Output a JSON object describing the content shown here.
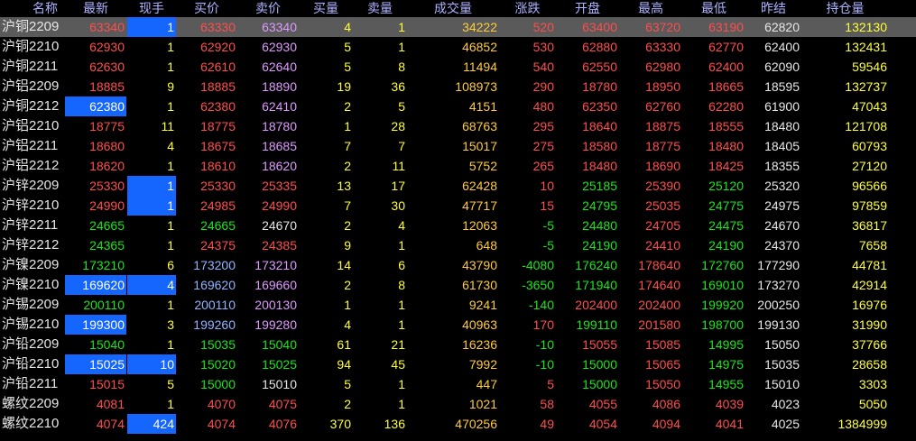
{
  "headers": {
    "name": "名称",
    "latest": "最新",
    "volume": "现手",
    "bid": "买价",
    "ask": "卖价",
    "bid_vol": "买量",
    "ask_vol": "卖量",
    "turnover": "成交量",
    "change": "涨跌",
    "open": "开盘",
    "high": "最高",
    "low": "最低",
    "prev_close": "昨结",
    "open_interest": "持仓量"
  },
  "rows": [
    {
      "name": "沪铜2209",
      "latest": "63340",
      "volume": "1",
      "bid": "63330",
      "ask": "63340",
      "bid_vol": "4",
      "ask_vol": "1",
      "turnover": "34222",
      "change": "520",
      "open": "63400",
      "high": "63720",
      "low": "63190",
      "prev_close": "62820",
      "open_interest": "132130"
    },
    {
      "name": "沪铜2210",
      "latest": "62930",
      "volume": "1",
      "bid": "62920",
      "ask": "62930",
      "bid_vol": "5",
      "ask_vol": "1",
      "turnover": "46852",
      "change": "530",
      "open": "62880",
      "high": "63330",
      "low": "62770",
      "prev_close": "62400",
      "open_interest": "132431"
    },
    {
      "name": "沪铜2211",
      "latest": "62630",
      "volume": "1",
      "bid": "62610",
      "ask": "62640",
      "bid_vol": "5",
      "ask_vol": "8",
      "turnover": "11494",
      "change": "540",
      "open": "62550",
      "high": "62980",
      "low": "62400",
      "prev_close": "62090",
      "open_interest": "59546"
    },
    {
      "name": "沪铝2209",
      "latest": "18885",
      "volume": "9",
      "bid": "18885",
      "ask": "18890",
      "bid_vol": "19",
      "ask_vol": "36",
      "turnover": "108973",
      "change": "290",
      "open": "18780",
      "high": "18950",
      "low": "18665",
      "prev_close": "18595",
      "open_interest": "132737"
    },
    {
      "name": "沪铜2212",
      "latest": "62380",
      "volume": "1",
      "bid": "62380",
      "ask": "62410",
      "bid_vol": "2",
      "ask_vol": "5",
      "turnover": "4151",
      "change": "480",
      "open": "62350",
      "high": "62760",
      "low": "62280",
      "prev_close": "61900",
      "open_interest": "47043"
    },
    {
      "name": "沪铝2210",
      "latest": "18775",
      "volume": "11",
      "bid": "18775",
      "ask": "18780",
      "bid_vol": "1",
      "ask_vol": "28",
      "turnover": "68763",
      "change": "295",
      "open": "18640",
      "high": "18875",
      "low": "18555",
      "prev_close": "18480",
      "open_interest": "121708"
    },
    {
      "name": "沪铝2211",
      "latest": "18680",
      "volume": "4",
      "bid": "18675",
      "ask": "18685",
      "bid_vol": "7",
      "ask_vol": "7",
      "turnover": "15017",
      "change": "275",
      "open": "18580",
      "high": "18775",
      "low": "18480",
      "prev_close": "18405",
      "open_interest": "60793"
    },
    {
      "name": "沪铝2212",
      "latest": "18620",
      "volume": "1",
      "bid": "18610",
      "ask": "18620",
      "bid_vol": "2",
      "ask_vol": "11",
      "turnover": "5752",
      "change": "265",
      "open": "18480",
      "high": "18690",
      "low": "18425",
      "prev_close": "18355",
      "open_interest": "27120"
    },
    {
      "name": "沪锌2209",
      "latest": "25330",
      "volume": "1",
      "bid": "25330",
      "ask": "25335",
      "bid_vol": "13",
      "ask_vol": "17",
      "turnover": "62428",
      "change": "10",
      "open": "25185",
      "high": "25390",
      "low": "25120",
      "prev_close": "25320",
      "open_interest": "96566"
    },
    {
      "name": "沪锌2210",
      "latest": "24990",
      "volume": "1",
      "bid": "24985",
      "ask": "24990",
      "bid_vol": "7",
      "ask_vol": "30",
      "turnover": "47717",
      "change": "15",
      "open": "24795",
      "high": "25035",
      "low": "24775",
      "prev_close": "24975",
      "open_interest": "97859"
    },
    {
      "name": "沪锌2211",
      "latest": "24665",
      "volume": "1",
      "bid": "24665",
      "ask": "24670",
      "bid_vol": "2",
      "ask_vol": "4",
      "turnover": "12063",
      "change": "-5",
      "open": "24480",
      "high": "24705",
      "low": "24475",
      "prev_close": "24670",
      "open_interest": "36817"
    },
    {
      "name": "沪锌2212",
      "latest": "24365",
      "volume": "1",
      "bid": "24375",
      "ask": "24385",
      "bid_vol": "9",
      "ask_vol": "1",
      "turnover": "648",
      "change": "-5",
      "open": "24190",
      "high": "24410",
      "low": "24190",
      "prev_close": "24370",
      "open_interest": "7658"
    },
    {
      "name": "沪镍2209",
      "latest": "173210",
      "volume": "6",
      "bid": "173200",
      "ask": "173210",
      "bid_vol": "14",
      "ask_vol": "6",
      "turnover": "43790",
      "change": "-4080",
      "open": "176240",
      "high": "178640",
      "low": "172760",
      "prev_close": "177290",
      "open_interest": "44781"
    },
    {
      "name": "沪镍2210",
      "latest": "169620",
      "volume": "4",
      "bid": "169620",
      "ask": "169660",
      "bid_vol": "2",
      "ask_vol": "8",
      "turnover": "61730",
      "change": "-3650",
      "open": "171940",
      "high": "174640",
      "low": "169010",
      "prev_close": "173270",
      "open_interest": "42914"
    },
    {
      "name": "沪锡2209",
      "latest": "200110",
      "volume": "1",
      "bid": "200110",
      "ask": "200130",
      "bid_vol": "1",
      "ask_vol": "1",
      "turnover": "9241",
      "change": "-140",
      "open": "202400",
      "high": "202400",
      "low": "199920",
      "prev_close": "200250",
      "open_interest": "16976"
    },
    {
      "name": "沪锡2210",
      "latest": "199300",
      "volume": "3",
      "bid": "199260",
      "ask": "199280",
      "bid_vol": "4",
      "ask_vol": "1",
      "turnover": "40963",
      "change": "170",
      "open": "199110",
      "high": "201580",
      "low": "198700",
      "prev_close": "199130",
      "open_interest": "31990"
    },
    {
      "name": "沪铅2209",
      "latest": "15040",
      "volume": "1",
      "bid": "15035",
      "ask": "15040",
      "bid_vol": "61",
      "ask_vol": "21",
      "turnover": "16236",
      "change": "-10",
      "open": "15055",
      "high": "15085",
      "low": "14995",
      "prev_close": "15050",
      "open_interest": "37766"
    },
    {
      "name": "沪铅2210",
      "latest": "15025",
      "volume": "10",
      "bid": "15020",
      "ask": "15025",
      "bid_vol": "94",
      "ask_vol": "45",
      "turnover": "7992",
      "change": "-10",
      "open": "15000",
      "high": "15065",
      "low": "14975",
      "prev_close": "15035",
      "open_interest": "28658"
    },
    {
      "name": "沪铅2211",
      "latest": "15015",
      "volume": "5",
      "bid": "15000",
      "ask": "15010",
      "bid_vol": "5",
      "ask_vol": "1",
      "turnover": "447",
      "change": "5",
      "open": "15000",
      "high": "15050",
      "low": "14955",
      "prev_close": "15010",
      "open_interest": "3303"
    },
    {
      "name": "螺纹2209",
      "latest": "4081",
      "volume": "1",
      "bid": "4070",
      "ask": "4075",
      "bid_vol": "2",
      "ask_vol": "1",
      "turnover": "1021",
      "change": "58",
      "open": "4055",
      "high": "4086",
      "low": "4039",
      "prev_close": "4023",
      "open_interest": "5050"
    },
    {
      "name": "螺纹2210",
      "latest": "4074",
      "volume": "424",
      "bid": "4074",
      "ask": "4076",
      "bid_vol": "370",
      "ask_vol": "136",
      "turnover": "470256",
      "change": "49",
      "open": "4054",
      "high": "4094",
      "low": "4041",
      "prev_close": "4025",
      "open_interest": "1384999"
    }
  ],
  "selected_row": 0,
  "highlight": {
    "latest": [
      4,
      13,
      15,
      17
    ],
    "volume": [
      0,
      8,
      9,
      13,
      17,
      20
    ]
  },
  "colors": {
    "up": "#ff4d4d",
    "down": "#19e619",
    "flat": "#e6e6e6",
    "highlight_bg": "#1466ff",
    "selected_bg": "#5a5a5a",
    "header": "#aeb1ff",
    "volume": "#ffff33",
    "open_interest": "#ffff33",
    "turnover": "#ffcc33"
  }
}
